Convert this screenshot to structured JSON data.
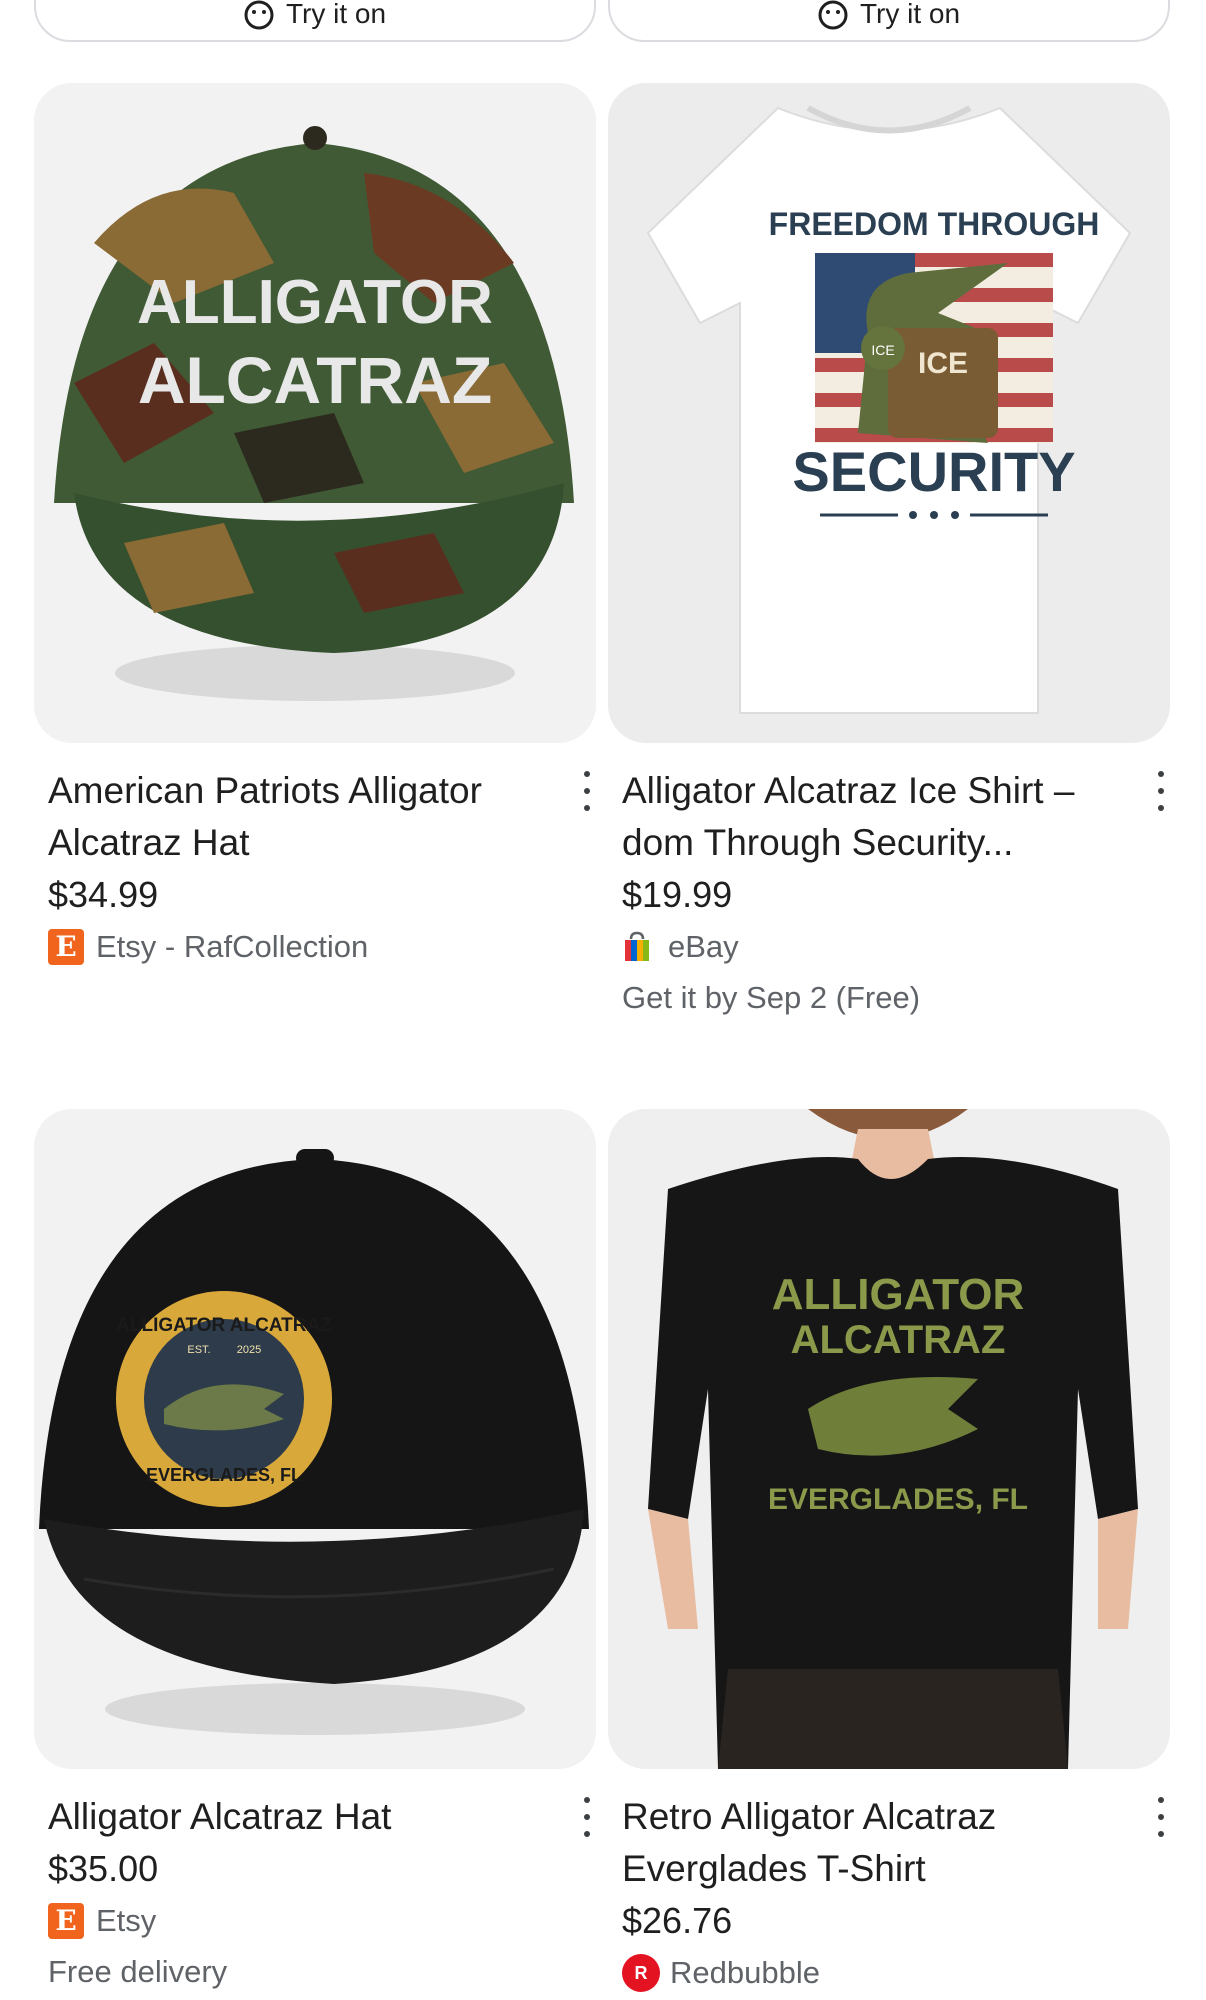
{
  "try_on": {
    "label": "Try it on"
  },
  "products": [
    {
      "title": "American Patriots Alligator Alcatraz Hat",
      "price": "$34.99",
      "seller": "Etsy - RafCollection",
      "seller_icon": "etsy-icon",
      "image_text": [
        "ALLIGATOR",
        "ALCATRAZ"
      ]
    },
    {
      "title": "Alligator Alcatraz Ice Shirt – dom Through Security...",
      "price": "$19.99",
      "seller": "eBay",
      "seller_icon": "ebay-icon",
      "delivery": "Get it by Sep 2 (Free)",
      "image_text": [
        "FREEDOM THROUGH",
        "SECURITY",
        "ICE",
        "ICE"
      ]
    },
    {
      "title": "Alligator Alcatraz Hat",
      "price": "$35.00",
      "seller": "Etsy",
      "seller_icon": "etsy-icon",
      "delivery": "Free delivery",
      "image_text": [
        "ALLIGATOR ALCATRAZ",
        "EST.",
        "2025",
        "EVERGLADES, FL"
      ]
    },
    {
      "title": "Retro Alligator Alcatraz Everglades T-Shirt",
      "price": "$26.76",
      "seller": "Redbubble",
      "seller_icon": "redbubble-icon",
      "image_text": [
        "ALLIGATOR",
        "ALCATRAZ",
        "EVERGLADES, FL"
      ]
    }
  ],
  "colors": {
    "etsy": "#f1641e",
    "redbubble": "#e41321",
    "text": "#1f1f1f",
    "secondary": "#5f6368"
  }
}
